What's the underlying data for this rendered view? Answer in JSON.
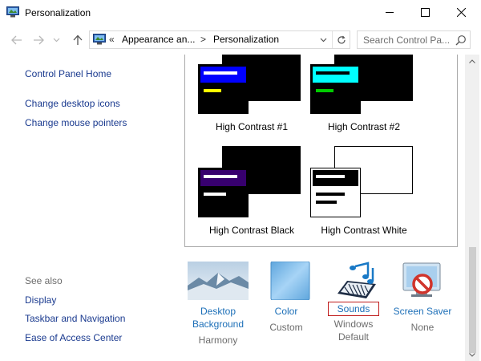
{
  "window": {
    "title": "Personalization",
    "icons": {
      "app": "control-panel-icon",
      "minimize": "minimize-icon",
      "maximize": "maximize-icon",
      "close": "close-icon"
    }
  },
  "nav": {
    "icons": {
      "back": "back-arrow-icon",
      "forward": "forward-arrow-icon",
      "history": "chevron-down-icon",
      "up": "up-arrow-icon",
      "refresh": "refresh-icon",
      "search": "search-icon"
    },
    "address": {
      "overflow": "«",
      "crumbs": [
        "Appearance an...",
        "Personalization"
      ],
      "separator": ">"
    },
    "search_placeholder": "Search Control Pa..."
  },
  "sidebar": {
    "home": "Control Panel Home",
    "links": [
      "Change desktop icons",
      "Change mouse pointers"
    ],
    "see_also_label": "See also",
    "see_also": [
      "Display",
      "Taskbar and Navigation",
      "Ease of Access Center"
    ]
  },
  "themes": [
    {
      "label": "High Contrast #1",
      "bg": "#000000",
      "title": "#0000ff",
      "bar1": "#ffffff",
      "bar2": "#ffff00",
      "frame": "#000000"
    },
    {
      "label": "High Contrast #2",
      "bg": "#000000",
      "title": "#00ffff",
      "bar1": "#000000",
      "bar2": "#00cc00",
      "frame": "#000000"
    },
    {
      "label": "High Contrast Black",
      "bg": "#000000",
      "title": "#37006e",
      "bar1": "#ffffff",
      "bar2": "#ffffff",
      "frame": "#000000"
    },
    {
      "label": "High Contrast White",
      "bg": "#ffffff",
      "title": "#ffffff",
      "bar1": "#000000",
      "bar2": "#000000",
      "frame": "#000000"
    }
  ],
  "bottom": [
    {
      "label": "Desktop Background",
      "label_lines": [
        "Desktop",
        "Background"
      ],
      "sub": "Harmony",
      "icon": "desktop-background-icon"
    },
    {
      "label": "Color",
      "label_lines": [
        "Color"
      ],
      "sub": "Custom",
      "icon": "color-icon"
    },
    {
      "label": "Sounds",
      "label_lines": [
        "Sounds"
      ],
      "sub": "Windows Default",
      "sub_lines": [
        "Windows",
        "Default"
      ],
      "icon": "sounds-icon"
    },
    {
      "label": "Screen Saver",
      "label_lines": [
        "Screen Saver"
      ],
      "sub": "None",
      "icon": "screen-saver-icon"
    }
  ],
  "colors": {
    "link": "#1a3a8f",
    "bottom_link": "#1c6fb8",
    "highlight_box": "#c01c1c",
    "sky": "#5fa6dd"
  }
}
